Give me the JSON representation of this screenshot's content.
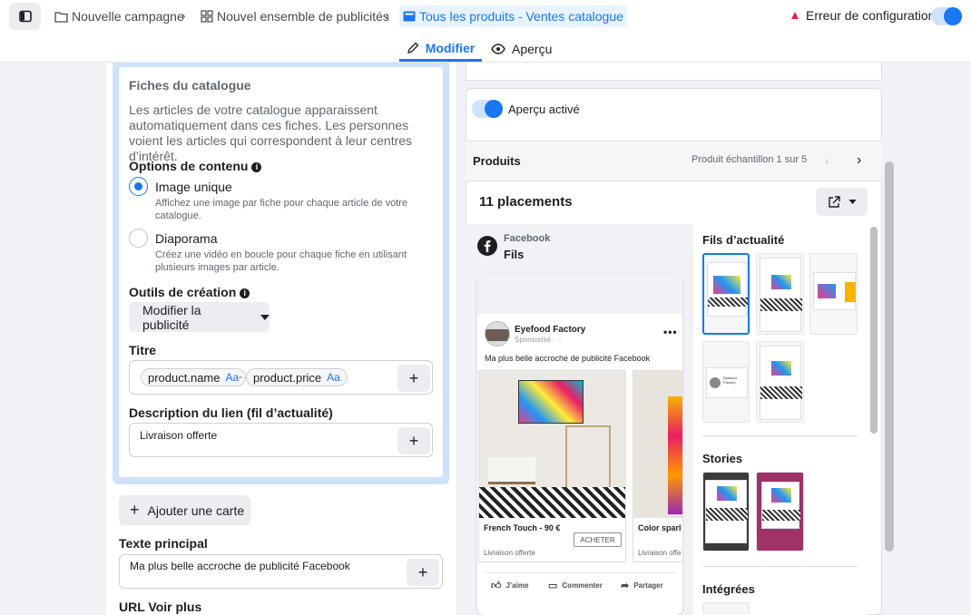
{
  "topbar": {
    "crumbs": [
      "Nouvelle campagne",
      "Nouvel ensemble de publicités",
      "Tous les produits - Ventes catalogue"
    ],
    "error_label": "Erreur de configuration"
  },
  "tabs": {
    "edit": "Modifier",
    "preview": "Aperçu"
  },
  "left": {
    "catalog_title": "Fiches du catalogue",
    "catalog_desc": "Les articles de votre catalogue apparaissent automatiquement dans ces fiches. Les personnes voient les articles qui correspondent à leur centres d’intérêt.",
    "content_options_label": "Options de contenu",
    "options": [
      {
        "title": "Image unique",
        "desc": "Affichez une image par fiche pour chaque article de votre catalogue.",
        "selected": true
      },
      {
        "title": "Diaporama",
        "desc": "Créez une vidéo en boucle pour chaque fiche en utilisant plusieurs images par article.",
        "selected": false
      }
    ],
    "tools_label": "Outils de création",
    "edit_ad_button": "Modifier la publicité",
    "title_label": "Titre",
    "title_chips": [
      "product.name",
      "product.price"
    ],
    "chip_suffix": "Aa",
    "chip_separator": "-",
    "link_desc_label": "Description du lien (fil d’actualité)",
    "link_desc_value": "Livraison offerte",
    "add_card_button": "Ajouter une carte",
    "primary_text_label": "Texte principal",
    "primary_text_value": "Ma plus belle accroche de publicité Facebook",
    "see_more_url_label": "URL Voir plus"
  },
  "right": {
    "preview_toggle_label": "Aperçu activé",
    "products_label": "Produits",
    "sample_label": "Produit échantillon 1 sur 5",
    "placements_label": "11 placements",
    "platform": "Facebook",
    "placement": "Fils",
    "post": {
      "page_name": "Eyefood Factory",
      "sponsored": "Sponsorisé · ",
      "text": "Ma plus belle accroche de publicité Facebook",
      "card1_title": "French Touch - 90 €",
      "card1_desc": "Livraison offerte",
      "card1_cta": "ACHETER",
      "card2_title": "Color sparl",
      "card2_desc": "Livraison offe",
      "actions": [
        "J’aime",
        "Commenter",
        "Partager"
      ]
    },
    "sections": {
      "feeds": "Fils d’actualité",
      "stories": "Stories",
      "integrated": "Intégrées"
    },
    "thumb_brand": "Eyefood Factory"
  },
  "colors": {
    "accent": "#1877f2",
    "error": "#e41e3f",
    "highlight": "#cfe2fb"
  }
}
